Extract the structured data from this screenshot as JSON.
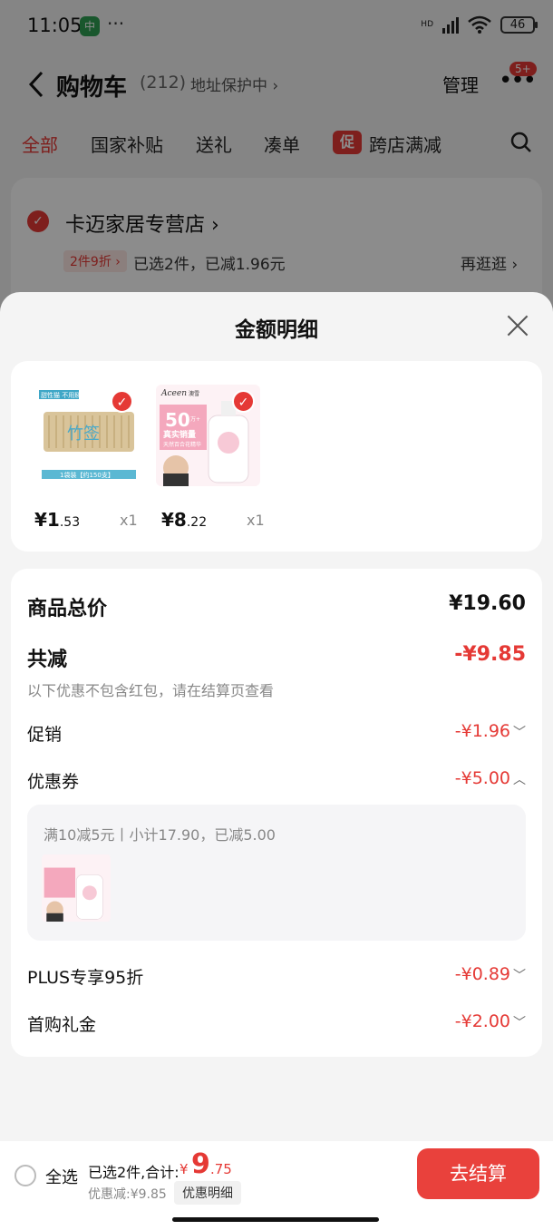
{
  "status_bar": {
    "time": "11:05",
    "app_icon": "中",
    "dots": "···",
    "hd": "HD",
    "battery": "46"
  },
  "header": {
    "title": "购物车",
    "count": "(212)",
    "address": "地址保护中 ›",
    "manage": "管理",
    "more_badge": "5+"
  },
  "tabs": [
    "全部",
    "国家补贴",
    "送礼",
    "凑单",
    "跨店满减"
  ],
  "promo_badge": "促",
  "store": {
    "name": "卡迈家居专营店",
    "arrow": "›",
    "tag": "2件9折 ›",
    "info": "已选2件，已减1.96元",
    "more": "再逛逛 ›"
  },
  "sheet": {
    "title": "金额明细",
    "products": [
      {
        "price_int": "¥1",
        "price_dec": ".53",
        "qty": "x1",
        "label_top": "甜性猫 不用掰",
        "label_mid": "竹签",
        "label_bottom": "1袋装【约150支】"
      },
      {
        "price_int": "¥8",
        "price_dec": ".22",
        "qty": "x1",
        "brand": "Aceen",
        "brand_cn": "澳雪",
        "sale": "50",
        "sale_unit": "万+",
        "sale_text": "真实销量",
        "sub": "天然百合花精华"
      }
    ],
    "summary": {
      "total_label": "商品总价",
      "total_value": "¥19.60",
      "reduce_label": "共减",
      "reduce_value": "-¥9.85",
      "note": "以下优惠不包含红包，请在结算页查看",
      "promo_label": "促销",
      "promo_value": "-¥1.96",
      "coupon_label": "优惠券",
      "coupon_value": "-¥5.00",
      "coupon_info": "满10减5元丨小计17.90，已减5.00",
      "plus_label": "PLUS专享95折",
      "plus_value": "-¥0.89",
      "gift_label": "首购礼金",
      "gift_value": "-¥2.00"
    }
  },
  "bottom_bar": {
    "select_all": "全选",
    "selected_info": "已选2件,合计:",
    "total_symbol": "¥",
    "total_int": "9",
    "total_dec": ".75",
    "discount_info": "优惠减:¥9.85",
    "detail_button": "优惠明细",
    "checkout": "去结算"
  },
  "colors": {
    "accent": "#e53935",
    "checkout": "#e9413c"
  }
}
